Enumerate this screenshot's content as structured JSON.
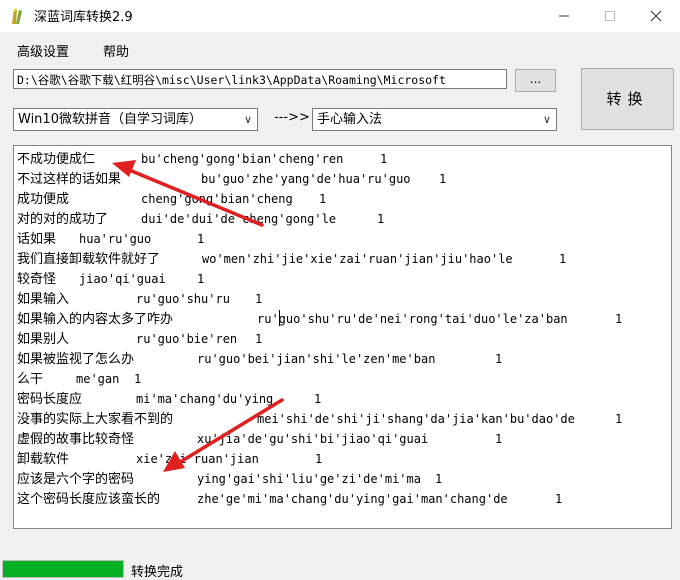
{
  "window": {
    "title": "深蓝词库转换2.9",
    "minimize_icon": "minimize-icon",
    "maximize_icon": "maximize-icon",
    "close_icon": "close-icon"
  },
  "menu": {
    "items": [
      "高级设置",
      "帮助"
    ]
  },
  "path": {
    "value": "D:\\谷歌\\谷歌下载\\红明谷\\misc\\User\\link3\\AppData\\Roaming\\Microsoft"
  },
  "browse_label": "...",
  "convert_label": "转换",
  "source_select": {
    "value": "Win10微软拼音（自学习词库）"
  },
  "arrow_label": "--->>",
  "target_select": {
    "value": "手心输入法"
  },
  "rows": [
    {
      "word": "不成功便成仁",
      "pinyin": "bu'cheng'gong'bian'cheng'ren",
      "count": "1"
    },
    {
      "word": "不过这样的话如果",
      "pinyin": "bu'guo'zhe'yang'de'hua'ru'guo",
      "count": "1"
    },
    {
      "word": "成功便成",
      "pinyin": "cheng'gong'bian'cheng",
      "count": "1"
    },
    {
      "word": "对的对的成功了",
      "pinyin": "dui'de'dui'de'cheng'gong'le",
      "count": "1"
    },
    {
      "word": "话如果",
      "pinyin": "hua'ru'guo",
      "count": "1"
    },
    {
      "word": "我们直接卸载软件就好了",
      "pinyin": "wo'men'zhi'jie'xie'zai'ruan'jian'jiu'hao'le",
      "count": "1"
    },
    {
      "word": "较奇怪",
      "pinyin": "jiao'qi'guai",
      "count": "1"
    },
    {
      "word": "如果输入",
      "pinyin": "ru'guo'shu'ru",
      "count": "1"
    },
    {
      "word": "如果输入的内容太多了咋办",
      "pinyin": "ru'guo'shu'ru'de'nei'rong'tai'duo'le'za'ban",
      "count": "1"
    },
    {
      "word": "如果别人",
      "pinyin": "ru'guo'bie'ren",
      "count": "1"
    },
    {
      "word": "如果被监视了怎么办",
      "pinyin": "ru'guo'bei'jian'shi'le'zen'me'ban",
      "count": "1"
    },
    {
      "word": "么干",
      "pinyin": "me'gan",
      "count": "1"
    },
    {
      "word": "密码长度应",
      "pinyin": "mi'ma'chang'du'ying",
      "count": "1"
    },
    {
      "word": "没事的实际上大家看不到的",
      "pinyin": "mei'shi'de'shi'ji'shang'da'jia'kan'bu'dao'de",
      "count": "1"
    },
    {
      "word": "虚假的故事比较奇怪",
      "pinyin": "xu'jia'de'gu'shi'bi'jiao'qi'guai",
      "count": "1"
    },
    {
      "word": "卸载软件",
      "pinyin": "xie'zai'ruan'jian",
      "count": "1"
    },
    {
      "word": "应该是六个字的密码",
      "pinyin": "ying'gai'shi'liu'ge'zi'de'mi'ma",
      "count": "1"
    },
    {
      "word": "这个密码长度应该蛮长的",
      "pinyin": "zhe'ge'mi'ma'chang'du'ying'gai'man'chang'de",
      "count": "1"
    }
  ],
  "status": {
    "text": "转换完成",
    "progress": 1.0,
    "progress_color": "#06b025"
  },
  "annotation": {
    "arrow_color": "#e02020",
    "arrow_count": 2
  }
}
